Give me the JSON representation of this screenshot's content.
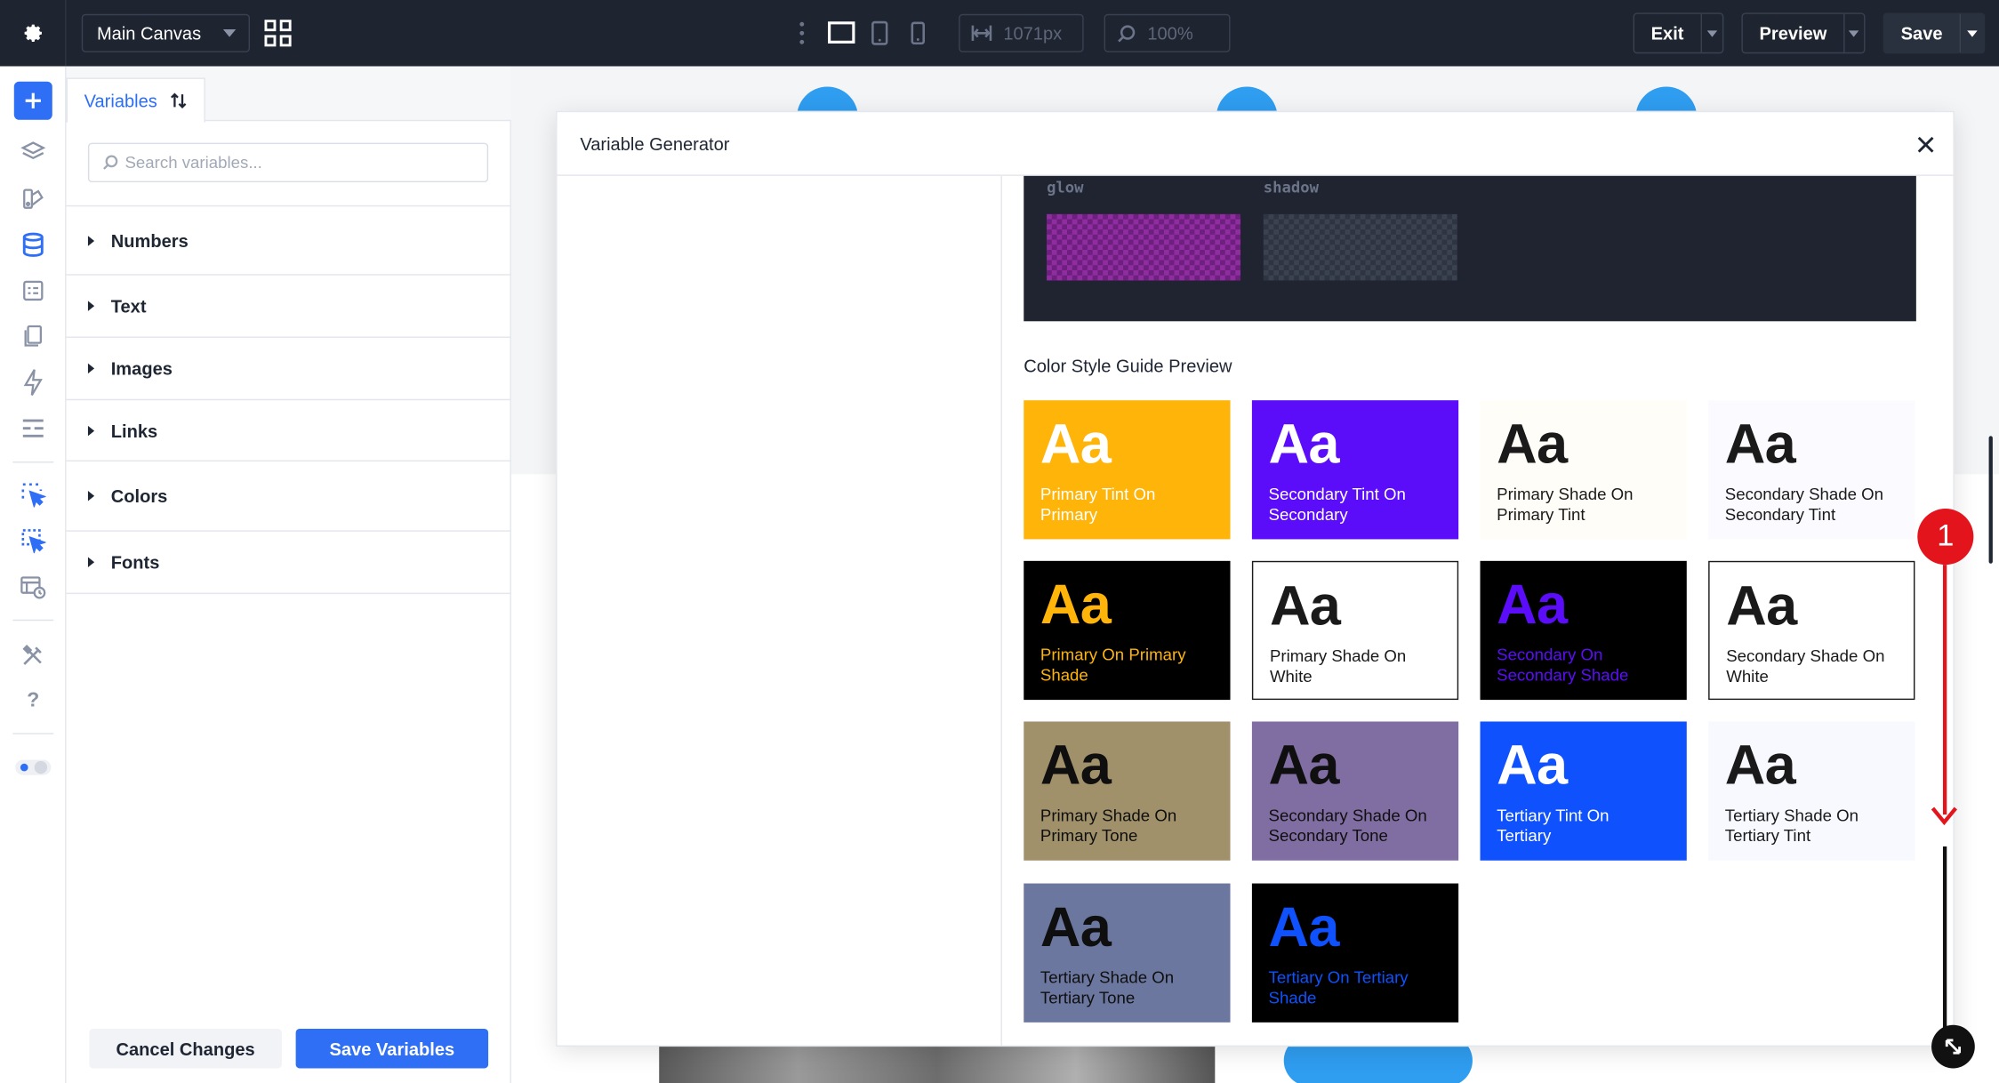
{
  "topbar": {
    "canvas_select": "Main Canvas",
    "width_value": "1071px",
    "zoom_value": "100%",
    "exit_label": "Exit",
    "preview_label": "Preview",
    "save_label": "Save"
  },
  "panel": {
    "tab_label": "Variables",
    "search_placeholder": "Search variables...",
    "sections": [
      "Numbers",
      "Text",
      "Images",
      "Links",
      "Colors",
      "Fonts"
    ],
    "cancel_label": "Cancel Changes",
    "save_label": "Save Variables"
  },
  "modal": {
    "title": "Variable Generator",
    "swatches": [
      {
        "label": "glow",
        "color": "#8e2ca0"
      },
      {
        "label": "shadow",
        "color": "#2e3441"
      }
    ],
    "guide_title": "Color Style Guide Preview",
    "cards": [
      {
        "aa": "Aa",
        "name": "Primary Tint On Primary",
        "bg": "#ffb40a",
        "fg": "#ffffff",
        "border": ""
      },
      {
        "aa": "Aa",
        "name": "Secondary Tint On Secondary",
        "bg": "#5b0df9",
        "fg": "#ffffff",
        "border": ""
      },
      {
        "aa": "Aa",
        "name": "Primary Shade On Primary Tint",
        "bg": "#fffdf7",
        "fg": "#1a1a1a",
        "border": ""
      },
      {
        "aa": "Aa",
        "name": "Secondary Shade On Secondary Tint",
        "bg": "#fbfaff",
        "fg": "#1a1a1a",
        "border": ""
      },
      {
        "aa": "Aa",
        "name": "Primary On Primary Shade",
        "bg": "#000000",
        "fg": "#ffb40a",
        "border": ""
      },
      {
        "aa": "Aa",
        "name": "Primary Shade On White",
        "bg": "#ffffff",
        "fg": "#1a1a1a",
        "border": "#1a1a1a"
      },
      {
        "aa": "Aa",
        "name": "Secondary On Secondary Shade",
        "bg": "#000000",
        "fg": "#5b0df9",
        "border": ""
      },
      {
        "aa": "Aa",
        "name": "Secondary Shade On White",
        "bg": "#ffffff",
        "fg": "#1a1a1a",
        "border": "#1a1a1a"
      },
      {
        "aa": "Aa",
        "name": "Primary Shade On Primary Tone",
        "bg": "#a0916b",
        "fg": "#0f0f0f",
        "border": ""
      },
      {
        "aa": "Aa",
        "name": "Secondary Shade On Secondary Tone",
        "bg": "#806ea3",
        "fg": "#0f0f0f",
        "border": ""
      },
      {
        "aa": "Aa",
        "name": "Tertiary Tint On Tertiary",
        "bg": "#0f51fc",
        "fg": "#ffffff",
        "border": ""
      },
      {
        "aa": "Aa",
        "name": "Tertiary Shade On Tertiary Tint",
        "bg": "#f8f9ff",
        "fg": "#1a1a1a",
        "border": ""
      },
      {
        "aa": "Aa",
        "name": "Tertiary Shade On Tertiary Tone",
        "bg": "#6b779f",
        "fg": "#0f0f0f",
        "border": ""
      },
      {
        "aa": "Aa",
        "name": "Tertiary On Tertiary Shade",
        "bg": "#000000",
        "fg": "#0f51fc",
        "border": ""
      }
    ]
  },
  "annotation": {
    "step_number": "1",
    "color": "#e4141d"
  },
  "colors": {
    "topbar_bg": "#1e2430",
    "accent": "#2e6ff6"
  },
  "icons": {
    "rail": [
      "plus-icon",
      "layers-icon",
      "design-icon",
      "database-icon",
      "form-icon",
      "pages-icon",
      "lightning-icon",
      "list-icon",
      "cursor-select-icon",
      "cursor-select-alt-icon",
      "template-icon",
      "tools-icon",
      "help-icon",
      "theme-toggle-icon"
    ]
  }
}
